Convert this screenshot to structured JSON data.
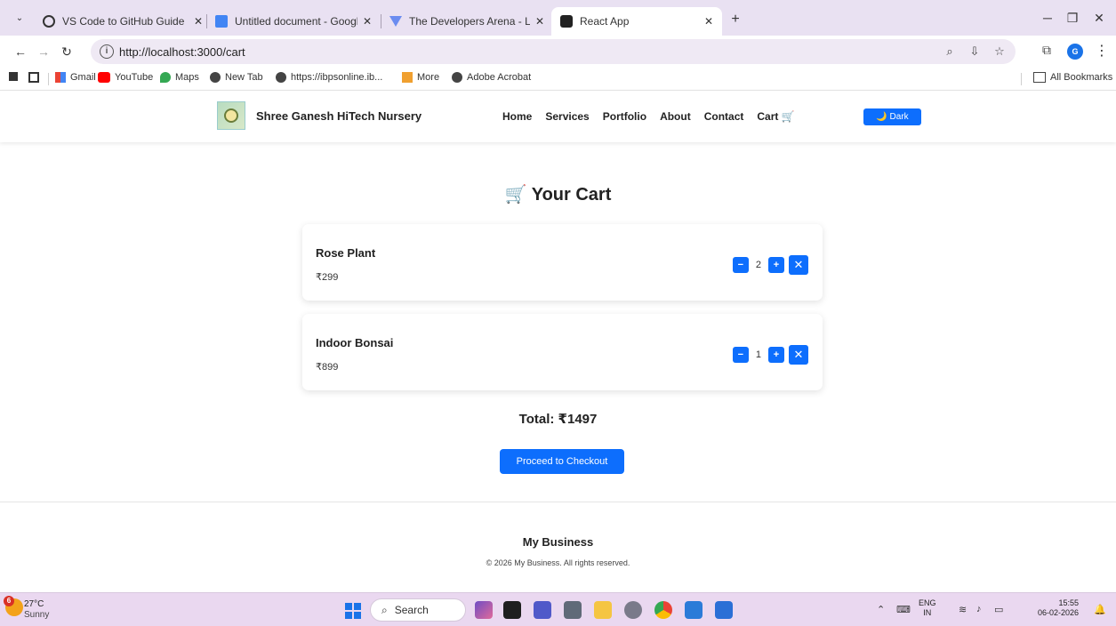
{
  "browser": {
    "tabs": [
      {
        "label": "VS Code to GitHub Guide"
      },
      {
        "label": "Untitled document - Google Do"
      },
      {
        "label": "The Developers Arena - Launch"
      },
      {
        "label": "React App"
      }
    ],
    "url": "http://localhost:3000/cart",
    "bookmarks": [
      "Gmail",
      "YouTube",
      "Maps",
      "New Tab",
      "https://ibpsonline.ib...",
      "More",
      "Adobe Acrobat"
    ],
    "all_bookmarks": "All Bookmarks",
    "profile_initial": "G",
    "accent": "#0d6efd"
  },
  "site": {
    "brand": "Shree Ganesh HiTech Nursery",
    "nav": [
      "Home",
      "Services",
      "Portfolio",
      "About",
      "Contact",
      "Cart 🛒"
    ],
    "dark_toggle": "🌙 Dark"
  },
  "cart": {
    "title": "🛒 Your Cart",
    "items": [
      {
        "name": "Rose Plant",
        "price": "₹299",
        "qty": "2"
      },
      {
        "name": "Indoor Bonsai",
        "price": "₹899",
        "qty": "1"
      }
    ],
    "minus": "−",
    "plus": "+",
    "remove": "✕",
    "total": "Total: ₹1497",
    "checkout": "Proceed to Checkout"
  },
  "footer": {
    "name": "My Business",
    "copyright": "© 2026 My Business. All rights reserved."
  },
  "taskbar": {
    "weather_badge": "6",
    "temp": "27°C",
    "condition": "Sunny",
    "search": "Search",
    "lang_top": "ENG",
    "lang_bottom": "IN",
    "time": "15:55",
    "date": "06-02-2026"
  }
}
